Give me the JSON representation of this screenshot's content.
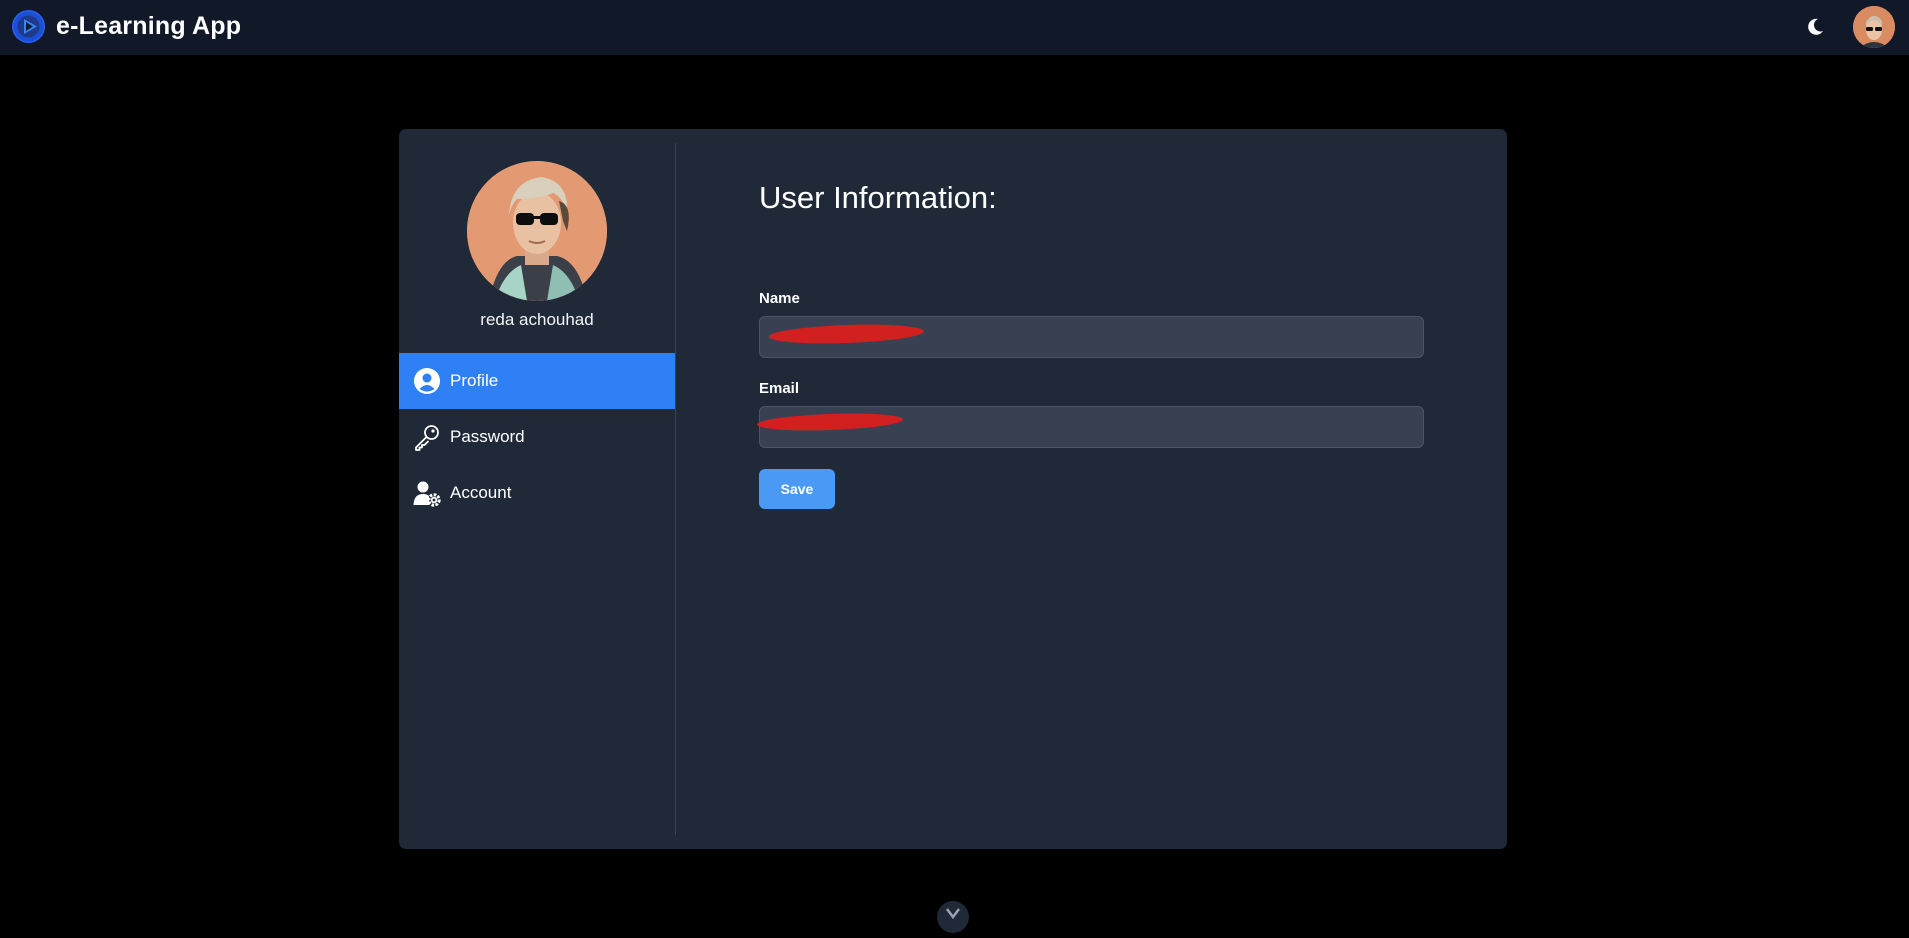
{
  "header": {
    "title": "e-Learning App",
    "logo_icon": "play-circle-icon",
    "theme_toggle_icon": "moon-icon",
    "avatar_icon": "user-avatar"
  },
  "sidebar": {
    "user_name": "reda achouhad",
    "items": [
      {
        "label": "Profile",
        "icon": "user-circle-icon",
        "active": true
      },
      {
        "label": "Password",
        "icon": "key-icon",
        "active": false
      },
      {
        "label": "Account",
        "icon": "user-gear-icon",
        "active": false
      }
    ]
  },
  "main": {
    "title": "User Information:",
    "fields": [
      {
        "label": "Name",
        "value": ""
      },
      {
        "label": "Email",
        "value": ""
      }
    ],
    "save_label": "Save"
  },
  "colors": {
    "background": "#000000",
    "topbar": "#111827",
    "card": "#1f2937",
    "active_nav": "#2f80f5",
    "input_bg": "#374151",
    "save_button": "#4a9af5",
    "redaction": "#d21f1f"
  }
}
